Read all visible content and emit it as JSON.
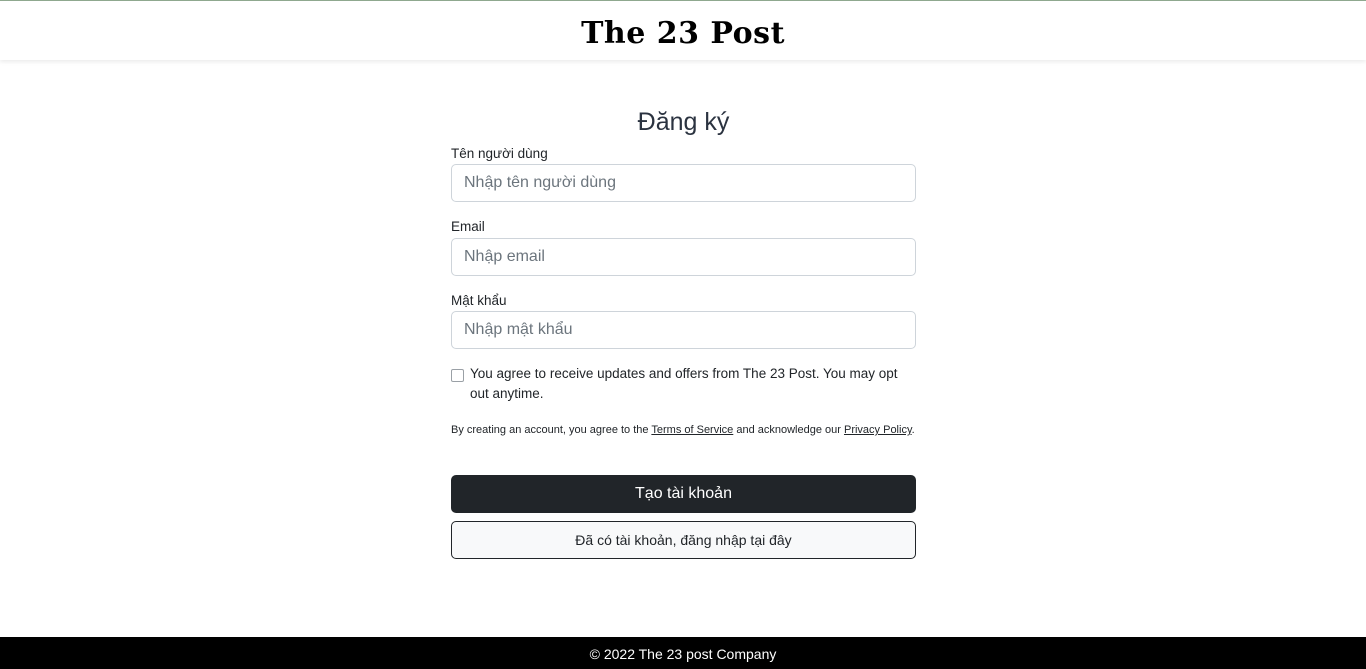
{
  "header": {
    "logo": "The 23 Post"
  },
  "form": {
    "title": "Đăng ký",
    "username": {
      "label": "Tên người dùng",
      "placeholder": "Nhập tên người dùng"
    },
    "email": {
      "label": "Email",
      "placeholder": "Nhập email"
    },
    "password": {
      "label": "Mật khẩu",
      "placeholder": "Nhập mật khẩu"
    },
    "consent": {
      "text": "You agree to receive updates and offers from The 23 Post. You may opt out anytime.",
      "checked": false
    },
    "terms": {
      "prefix": "By creating an account, you agree to the ",
      "terms_link": "Terms of Service",
      "middle": " and acknowledge our ",
      "privacy_link": "Privacy Policy",
      "suffix": "."
    },
    "submit_label": "Tạo tài khoản",
    "login_label": "Đã có tài khoản, đăng nhập tại đây"
  },
  "footer": {
    "text": "© 2022 The 23 post Company"
  }
}
